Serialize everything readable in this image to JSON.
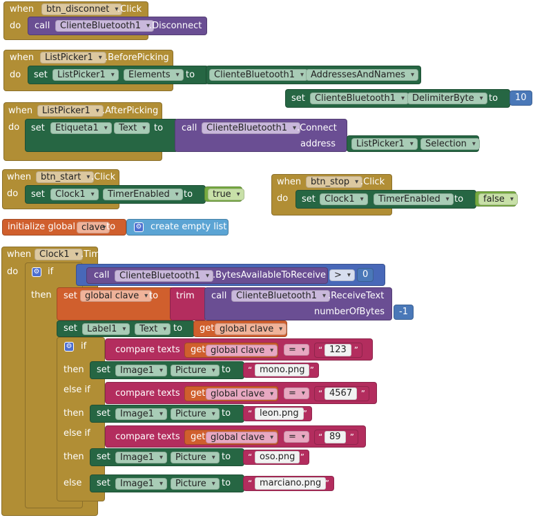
{
  "blocks": {
    "disconnect": {
      "when": "when",
      "component": "btn_disconnet",
      "event": ".Click",
      "do": "do",
      "call": "call",
      "target": "ClienteBluetooth1",
      "method": ".Disconnect"
    },
    "before": {
      "when": "when",
      "component": "ListPicker1",
      "event": ".BeforePicking",
      "do": "do",
      "set": "set",
      "comp": "ListPicker1",
      "prop": "Elements",
      "to": "to",
      "src": "ClienteBluetooth1",
      "src_prop": "AddressesAndNames"
    },
    "delim": {
      "set": "set",
      "comp": "ClienteBluetooth1",
      "prop": "DelimiterByte",
      "to": "to",
      "value": "10"
    },
    "after": {
      "when": "when",
      "component": "ListPicker1",
      "event": ".AfterPicking",
      "do": "do",
      "set": "set",
      "comp": "Etiqueta1",
      "prop": "Text",
      "to": "to",
      "call": "call",
      "target": "ClienteBluetooth1",
      "method": ".Connect",
      "arg": "address",
      "arg_comp": "ListPicker1",
      "arg_prop": "Selection"
    },
    "start": {
      "when": "when",
      "component": "btn_start",
      "event": ".Click",
      "do": "do",
      "set": "set",
      "comp": "Clock1",
      "prop": "TimerEnabled",
      "to": "to",
      "value": "true"
    },
    "stop": {
      "when": "when",
      "component": "btn_stop",
      "event": ".Click",
      "do": "do",
      "set": "set",
      "comp": "Clock1",
      "prop": "TimerEnabled",
      "to": "to",
      "value": "false"
    },
    "global": {
      "label": "initialize global",
      "name": "clave",
      "to": "to",
      "list": "create empty list"
    },
    "timer": {
      "when": "when",
      "component": "Clock1",
      "event": ".Timer",
      "do": "do",
      "if": "if",
      "call": "call",
      "bt": "ClienteBluetooth1",
      "bytes": ".BytesAvailableToReceive",
      "op_gt": ">",
      "zero": "0",
      "then": "then",
      "set": "set",
      "global_clave": "global clave",
      "to": "to",
      "trim": "trim",
      "receive": ".ReceiveText",
      "numbytes": "numberOfBytes",
      "neg1": "-1",
      "label_comp": "Label1",
      "label_prop": "Text",
      "get": "get",
      "compare": "compare texts",
      "op_eq": "=",
      "else_if": "else if",
      "else": "else",
      "image": "Image1",
      "picture": "Picture",
      "values": [
        "123",
        "4567",
        "89"
      ],
      "files": [
        "mono.png",
        "leon.png",
        "oso.png",
        "marciano.png"
      ]
    }
  },
  "icons": {
    "gear": "gear-icon"
  }
}
